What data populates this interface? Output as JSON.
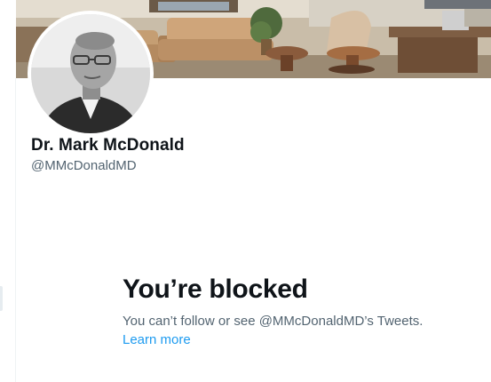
{
  "profile": {
    "display_name": "Dr. Mark McDonald",
    "handle": "@MMcDonaldMD"
  },
  "blocked": {
    "title": "You’re blocked",
    "message": "You can’t follow or see @MMcDonaldMD’s Tweets.",
    "learn_more": "Learn more"
  },
  "colors": {
    "primary_text": "#0f1419",
    "secondary_text": "#536471",
    "link": "#1d9bf0",
    "divider": "#eff3f4"
  }
}
